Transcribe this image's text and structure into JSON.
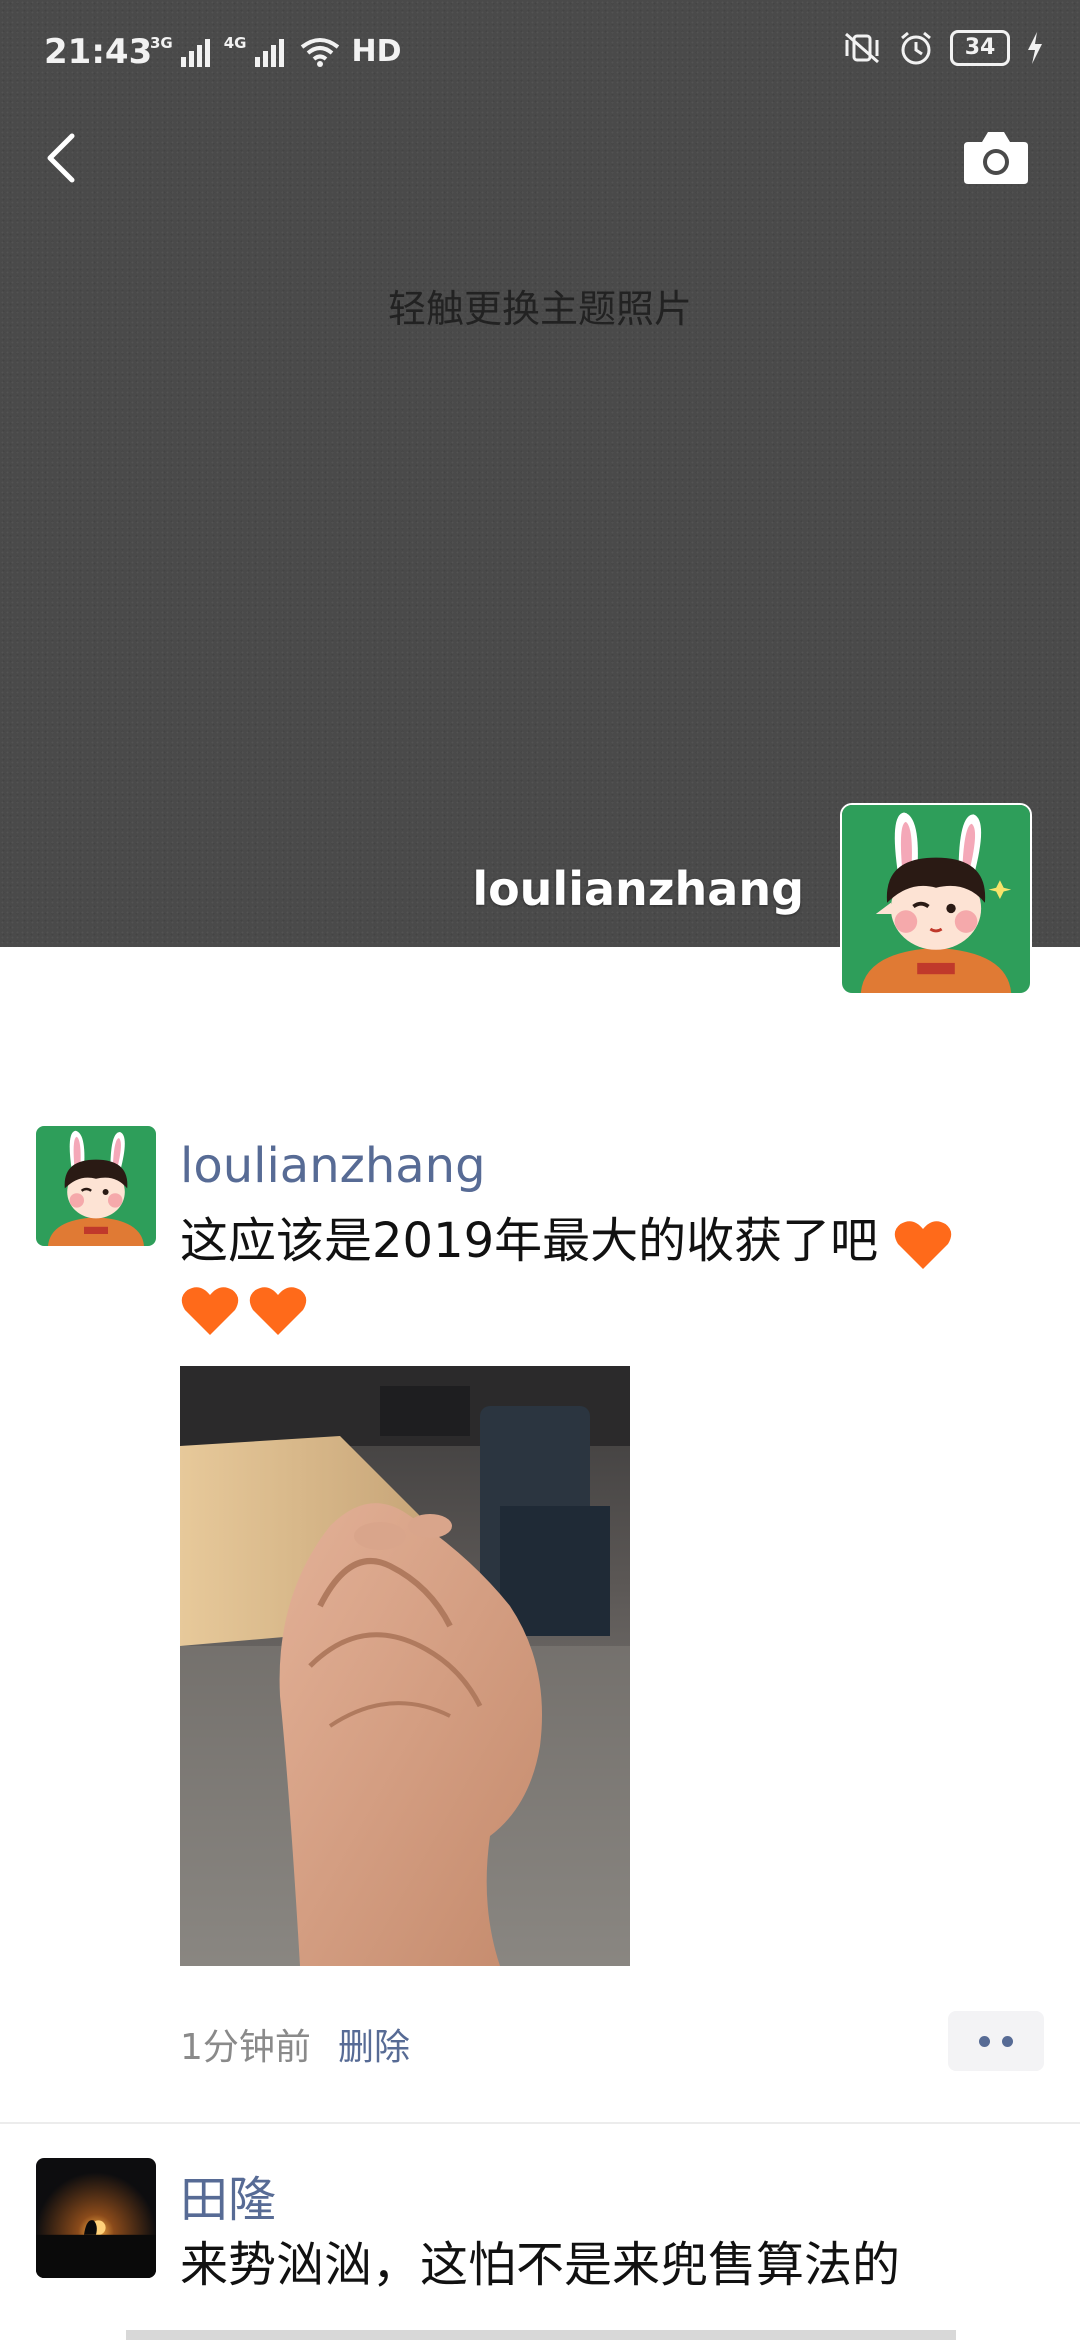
{
  "status_bar": {
    "time": "21:43",
    "network_1": "3G",
    "network_2": "4G",
    "hd_label": "HD",
    "battery": "34",
    "icons": [
      "signal-icon",
      "wifi-icon",
      "vibrate-off-icon",
      "alarm-icon",
      "battery-icon",
      "charging-icon"
    ]
  },
  "cover": {
    "hint": "轻触更换主题照片",
    "username": "loulianzhang",
    "background_color": "#4a4a4a"
  },
  "posts": [
    {
      "author": "loulianzhang",
      "text": "这应该是2019年最大的收获了吧",
      "time": "1分钟前",
      "delete_label": "删除"
    },
    {
      "author": "田隆",
      "text": "来势汹汹，这怕不是来兜售算法的"
    }
  ],
  "colors": {
    "link_blue": "#576b95",
    "heart_orange": "#ff6a1a"
  }
}
